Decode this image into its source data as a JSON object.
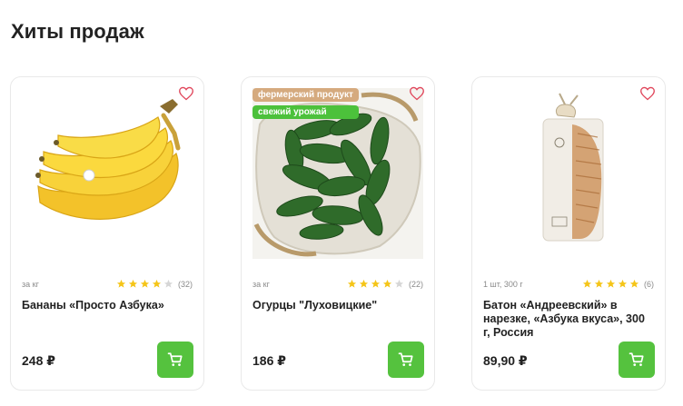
{
  "section": {
    "title": "Хиты продаж"
  },
  "colors": {
    "accent": "#55c23e",
    "badge_farm": "#d5aa7e",
    "badge_fresh": "#4cc13b",
    "star": "#f5c518",
    "star_empty": "#d6d6d6"
  },
  "products": [
    {
      "name": "Бананы «Просто Азбука»",
      "unit": "за кг",
      "rating": 4,
      "reviews": "(32)",
      "price": "248 ₽",
      "badges": []
    },
    {
      "name": "Огурцы \"Луховицкие\"",
      "unit": "за кг",
      "rating": 4,
      "reviews": "(22)",
      "price": "186 ₽",
      "badges": [
        "фермерский продукт",
        "свежий урожай"
      ]
    },
    {
      "name": "Батон «Андреевский» в нарезке, «Азбука вкуса», 300 г, Россия",
      "unit": "1 шт, 300 г",
      "rating": 5,
      "reviews": "(6)",
      "price": "89,90 ₽",
      "badges": []
    }
  ]
}
